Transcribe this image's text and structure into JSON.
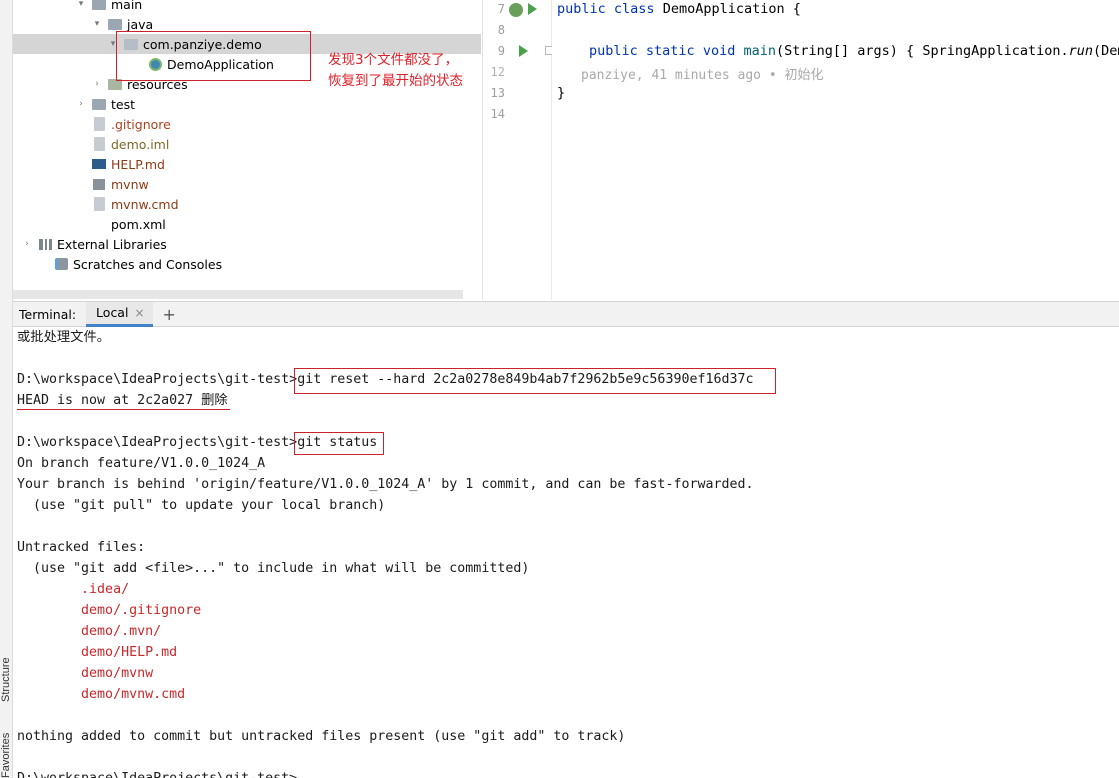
{
  "side_tabs": {
    "structure": "Structure",
    "favorites": "Favorites"
  },
  "tree": [
    {
      "label": "main",
      "arrow": "▾",
      "icon": "folder-icon",
      "color": "#000000"
    },
    {
      "label": "java",
      "arrow": "▾",
      "icon": "folder-icon",
      "color": "#000000"
    },
    {
      "label": "com.panziye.demo",
      "arrow": "▾",
      "icon": "package-icon",
      "color": "#000000",
      "selected": true
    },
    {
      "label": "DemoApplication",
      "arrow": "",
      "icon": "spring-class-icon",
      "color": "#000000"
    },
    {
      "label": "resources",
      "arrow": "›",
      "icon": "resources-folder-icon",
      "color": "#000000"
    },
    {
      "label": "test",
      "arrow": "›",
      "icon": "folder-icon",
      "color": "#000000"
    },
    {
      "label": ".gitignore",
      "arrow": "",
      "icon": "file-icon",
      "color": "#b04020"
    },
    {
      "label": "demo.iml",
      "arrow": "",
      "icon": "file-icon",
      "color": "#7a6a2a"
    },
    {
      "label": "HELP.md",
      "arrow": "",
      "icon": "markdown-icon",
      "color": "#8c3a16"
    },
    {
      "label": "mvnw",
      "arrow": "",
      "icon": "terminal-file-icon",
      "color": "#8c3a16"
    },
    {
      "label": "mvnw.cmd",
      "arrow": "",
      "icon": "file-icon",
      "color": "#8c3a16"
    },
    {
      "label": "pom.xml",
      "arrow": "",
      "icon": "maven-icon",
      "color": "#000000"
    },
    {
      "label": "External Libraries",
      "arrow": "›",
      "icon": "libraries-icon",
      "color": "#000000"
    },
    {
      "label": "Scratches and Consoles",
      "arrow": "",
      "icon": "scratches-icon",
      "color": "#000000"
    }
  ],
  "annotation": {
    "line1": "发现3个文件都没了，",
    "line2": "恢复到了最开始的状态"
  },
  "editor": {
    "line_numbers": [
      "7",
      "8",
      "9",
      "12",
      "13",
      "14"
    ],
    "line7": {
      "kw1": "public",
      "kw2": "class",
      "name": "DemoApplication",
      "rest": " {"
    },
    "line9": {
      "kw1": "public",
      "kw2": "static",
      "kw3": "void",
      "method": "main",
      "args": "(String[] args) { SpringApplication.",
      "run": "run",
      "tail": "(Demo"
    },
    "blame": "panziye, 41 minutes ago • 初始化",
    "line13": "}"
  },
  "terminal": {
    "title": "Terminal:",
    "tab_local": "Local",
    "close_glyph": "×",
    "add_glyph": "+",
    "lines": [
      {
        "text": "或批处理文件。",
        "red": false
      },
      {
        "text": "",
        "red": false
      },
      {
        "text": "D:\\workspace\\IdeaProjects\\git-test>git reset --hard 2c2a0278e849b4ab7f2962b5e9c56390ef16d37c",
        "red": false
      },
      {
        "text": "HEAD is now at 2c2a027 删除",
        "red": false
      },
      {
        "text": "",
        "red": false
      },
      {
        "text": "D:\\workspace\\IdeaProjects\\git-test>git status",
        "red": false
      },
      {
        "text": "On branch feature/V1.0.0_1024_A",
        "red": false
      },
      {
        "text": "Your branch is behind 'origin/feature/V1.0.0_1024_A' by 1 commit, and can be fast-forwarded.",
        "red": false
      },
      {
        "text": "  (use \"git pull\" to update your local branch)",
        "red": false
      },
      {
        "text": "",
        "red": false
      },
      {
        "text": "Untracked files:",
        "red": false
      },
      {
        "text": "  (use \"git add <file>...\" to include in what will be committed)",
        "red": false
      },
      {
        "text": "        .idea/",
        "red": true
      },
      {
        "text": "        demo/.gitignore",
        "red": true
      },
      {
        "text": "        demo/.mvn/",
        "red": true
      },
      {
        "text": "        demo/HELP.md",
        "red": true
      },
      {
        "text": "        demo/mvnw",
        "red": true
      },
      {
        "text": "        demo/mvnw.cmd",
        "red": true
      },
      {
        "text": "",
        "red": false
      },
      {
        "text": "nothing added to commit but untracked files present (use \"git add\" to track)",
        "red": false
      },
      {
        "text": "",
        "red": false
      },
      {
        "text": "D:\\workspace\\IdeaProjects\\git-test>",
        "red": false
      }
    ]
  },
  "colors": {
    "annotation_red": "#d0202a",
    "keyword": "#0033b3",
    "method": "#00627a"
  }
}
